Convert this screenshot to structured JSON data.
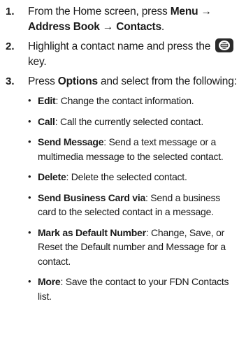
{
  "steps": [
    {
      "number": "1.",
      "text_a": "From the Home screen, press ",
      "bold_a": "Menu",
      "arrow_1": " → ",
      "bold_b": "Address Book",
      "arrow_2": " → ",
      "bold_c": "Contacts",
      "end": "."
    },
    {
      "number": "2.",
      "text_a": "Highlight a contact name and press the",
      "key_icon": "center-select-key-icon",
      "text_b": "key."
    },
    {
      "number": "3.",
      "text_a": "Press ",
      "bold_a": "Options",
      "text_b": " and select from the following:"
    }
  ],
  "options": [
    {
      "term": "Edit",
      "desc": ": Change the contact information."
    },
    {
      "term": "Call",
      "desc": ": Call the currently selected contact."
    },
    {
      "term": "Send Message",
      "desc": ": Send a text message or a multimedia message to the selected contact."
    },
    {
      "term": "Delete",
      "desc": ": Delete the selected contact."
    },
    {
      "term": "Send Business Card via",
      "desc": ": Send a business card to the selected contact in a message."
    },
    {
      "term": "Mark as Default Number",
      "desc": ": Change, Save, or Reset the Default number and Message for a contact."
    },
    {
      "term": "More",
      "desc": ": Save the contact to your FDN Contacts list."
    }
  ],
  "bullet": "•",
  "colors": {
    "text": "#1a1a1a",
    "key_bg": "#2b2b2b",
    "key_glyph": "#ffffff"
  }
}
